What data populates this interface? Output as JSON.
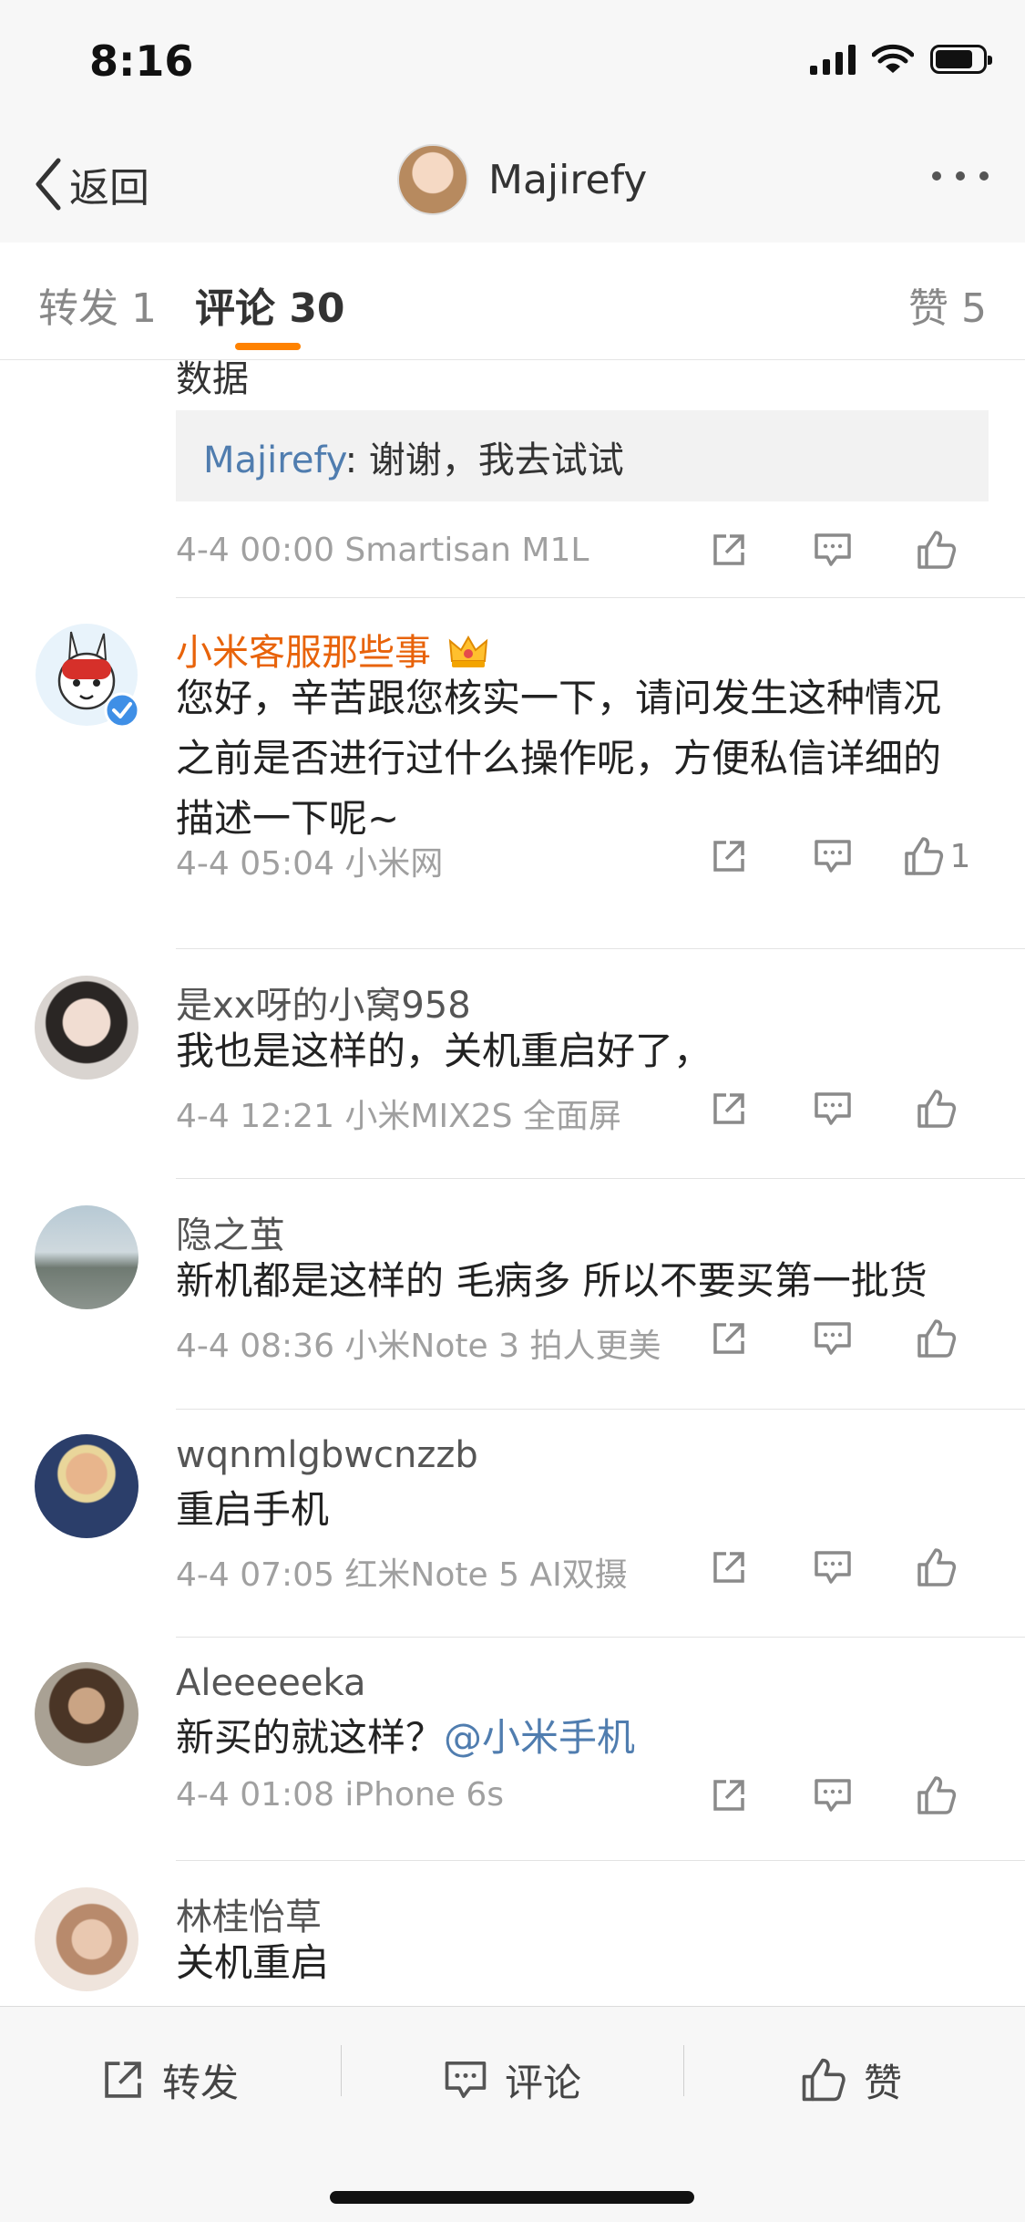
{
  "status_bar": {
    "time": "8:16"
  },
  "nav": {
    "back_label": "返回",
    "title": "Majirefy"
  },
  "tabs": [
    {
      "label": "转发 1"
    },
    {
      "label": "评论 30"
    },
    {
      "label": "赞 5"
    }
  ],
  "partial_comment": {
    "cut_text": "数据",
    "quote_name": "Majirefy",
    "quote_text": ": 谢谢，我去试试",
    "meta": "4-4 00:00  Smartisan M1L"
  },
  "comments": [
    {
      "name": "小米客服那些事",
      "text": "您好，辛苦跟您核实一下，请问发生这种情况之前是否进行过什么操作呢，方便私信详细的描述一下呢~",
      "meta": "4-4 05:04  小米网",
      "likes": "1"
    },
    {
      "name": "是xx呀的小窝958",
      "text": "我也是这样的，关机重启好了，",
      "meta": "4-4 12:21  小米MIX2S 全面屏"
    },
    {
      "name": "隐之茧",
      "text": "新机都是这样的 毛病多 所以不要买第一批货",
      "meta": "4-4 08:36  小米Note 3 拍人更美"
    },
    {
      "name": "wqnmlgbwcnzzb",
      "text": "重启手机",
      "meta": "4-4 07:05  红米Note 5 AI双摄"
    },
    {
      "name": "Aleeeeeka",
      "text": "新买的就这样？",
      "mention": "@小米手机",
      "meta": "4-4 01:08  iPhone 6s"
    },
    {
      "name": "林桂怡草",
      "text": "关机重启"
    }
  ],
  "bottom_bar": {
    "repost": "转发",
    "comment": "评论",
    "like": "赞"
  },
  "colors": {
    "accent": "#ff8200",
    "link": "#507daf",
    "vip_name": "#e8630a",
    "verified": "#3f8fe6"
  }
}
